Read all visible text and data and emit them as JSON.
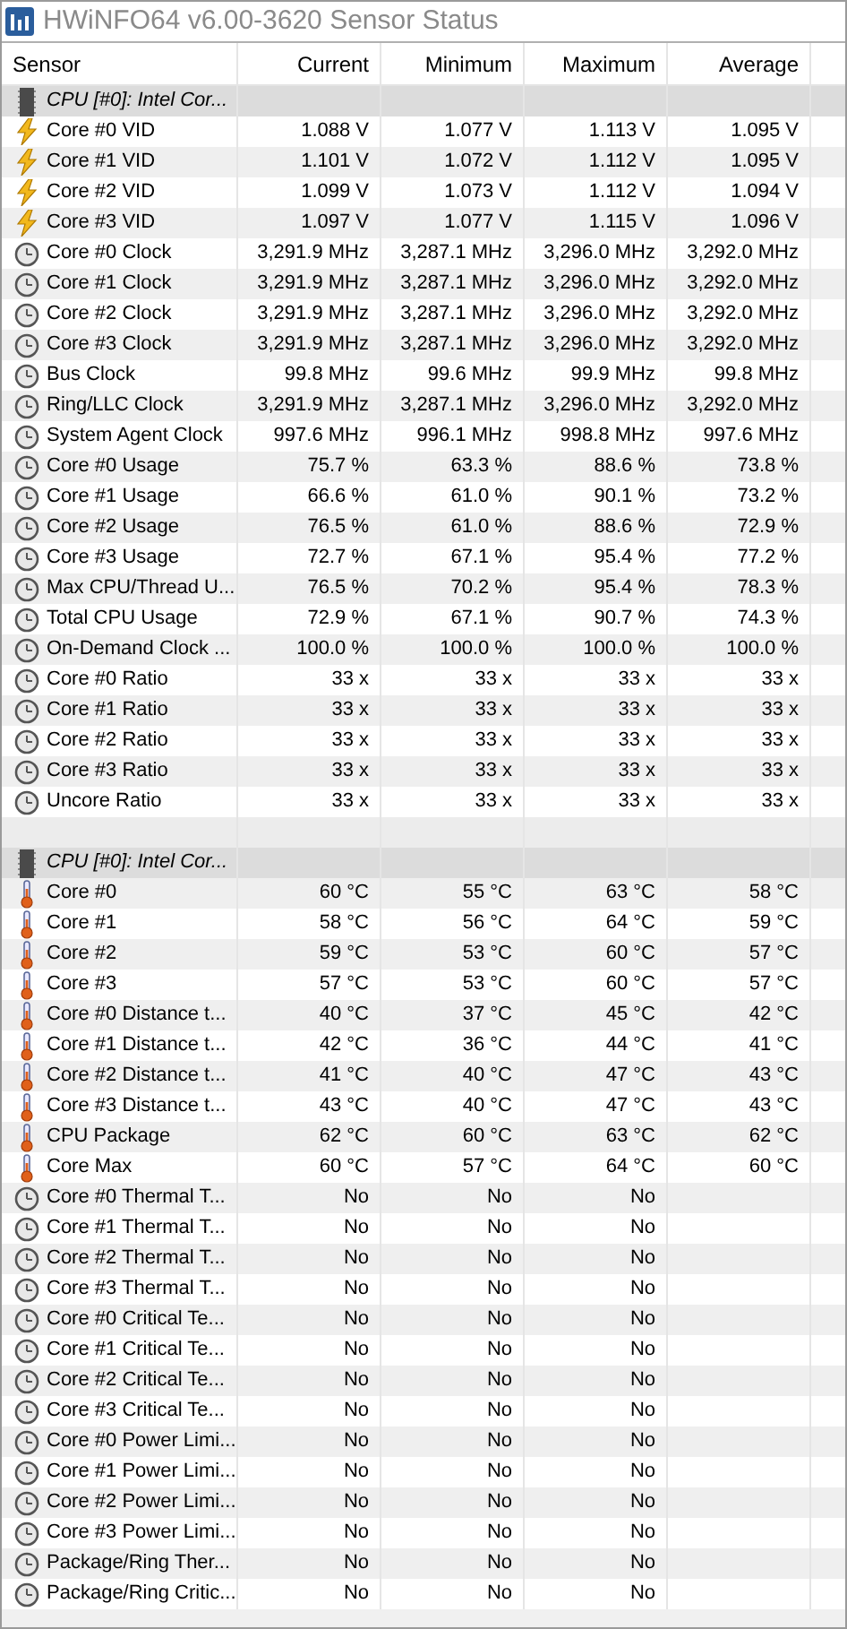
{
  "window": {
    "title": "HWiNFO64 v6.00-3620 Sensor Status"
  },
  "table": {
    "columns": [
      "Sensor",
      "Current",
      "Minimum",
      "Maximum",
      "Average"
    ],
    "rows": [
      {
        "kind": "group",
        "sensor": "CPU [#0]: Intel Cor..."
      },
      {
        "kind": "voltage",
        "sensor": "Core #0 VID",
        "current": "1.088 V",
        "minimum": "1.077 V",
        "maximum": "1.113 V",
        "average": "1.095 V"
      },
      {
        "kind": "voltage",
        "sensor": "Core #1 VID",
        "current": "1.101 V",
        "minimum": "1.072 V",
        "maximum": "1.112 V",
        "average": "1.095 V"
      },
      {
        "kind": "voltage",
        "sensor": "Core #2 VID",
        "current": "1.099 V",
        "minimum": "1.073 V",
        "maximum": "1.112 V",
        "average": "1.094 V"
      },
      {
        "kind": "voltage",
        "sensor": "Core #3 VID",
        "current": "1.097 V",
        "minimum": "1.077 V",
        "maximum": "1.115 V",
        "average": "1.096 V"
      },
      {
        "kind": "clock",
        "sensor": "Core #0 Clock",
        "current": "3,291.9 MHz",
        "minimum": "3,287.1 MHz",
        "maximum": "3,296.0 MHz",
        "average": "3,292.0 MHz"
      },
      {
        "kind": "clock",
        "sensor": "Core #1 Clock",
        "current": "3,291.9 MHz",
        "minimum": "3,287.1 MHz",
        "maximum": "3,296.0 MHz",
        "average": "3,292.0 MHz"
      },
      {
        "kind": "clock",
        "sensor": "Core #2 Clock",
        "current": "3,291.9 MHz",
        "minimum": "3,287.1 MHz",
        "maximum": "3,296.0 MHz",
        "average": "3,292.0 MHz"
      },
      {
        "kind": "clock",
        "sensor": "Core #3 Clock",
        "current": "3,291.9 MHz",
        "minimum": "3,287.1 MHz",
        "maximum": "3,296.0 MHz",
        "average": "3,292.0 MHz"
      },
      {
        "kind": "clock",
        "sensor": "Bus Clock",
        "current": "99.8 MHz",
        "minimum": "99.6 MHz",
        "maximum": "99.9 MHz",
        "average": "99.8 MHz"
      },
      {
        "kind": "clock",
        "sensor": "Ring/LLC Clock",
        "current": "3,291.9 MHz",
        "minimum": "3,287.1 MHz",
        "maximum": "3,296.0 MHz",
        "average": "3,292.0 MHz"
      },
      {
        "kind": "clock",
        "sensor": "System Agent Clock",
        "current": "997.6 MHz",
        "minimum": "996.1 MHz",
        "maximum": "998.8 MHz",
        "average": "997.6 MHz"
      },
      {
        "kind": "clock",
        "sensor": "Core #0 Usage",
        "current": "75.7 %",
        "minimum": "63.3 %",
        "maximum": "88.6 %",
        "average": "73.8 %"
      },
      {
        "kind": "clock",
        "sensor": "Core #1 Usage",
        "current": "66.6 %",
        "minimum": "61.0 %",
        "maximum": "90.1 %",
        "average": "73.2 %"
      },
      {
        "kind": "clock",
        "sensor": "Core #2 Usage",
        "current": "76.5 %",
        "minimum": "61.0 %",
        "maximum": "88.6 %",
        "average": "72.9 %"
      },
      {
        "kind": "clock",
        "sensor": "Core #3 Usage",
        "current": "72.7 %",
        "minimum": "67.1 %",
        "maximum": "95.4 %",
        "average": "77.2 %"
      },
      {
        "kind": "clock",
        "sensor": "Max CPU/Thread U...",
        "current": "76.5 %",
        "minimum": "70.2 %",
        "maximum": "95.4 %",
        "average": "78.3 %"
      },
      {
        "kind": "clock",
        "sensor": "Total CPU Usage",
        "current": "72.9 %",
        "minimum": "67.1 %",
        "maximum": "90.7 %",
        "average": "74.3 %"
      },
      {
        "kind": "clock",
        "sensor": "On-Demand Clock ...",
        "current": "100.0 %",
        "minimum": "100.0 %",
        "maximum": "100.0 %",
        "average": "100.0 %"
      },
      {
        "kind": "clock",
        "sensor": "Core #0 Ratio",
        "current": "33 x",
        "minimum": "33 x",
        "maximum": "33 x",
        "average": "33 x"
      },
      {
        "kind": "clock",
        "sensor": "Core #1 Ratio",
        "current": "33 x",
        "minimum": "33 x",
        "maximum": "33 x",
        "average": "33 x"
      },
      {
        "kind": "clock",
        "sensor": "Core #2 Ratio",
        "current": "33 x",
        "minimum": "33 x",
        "maximum": "33 x",
        "average": "33 x"
      },
      {
        "kind": "clock",
        "sensor": "Core #3 Ratio",
        "current": "33 x",
        "minimum": "33 x",
        "maximum": "33 x",
        "average": "33 x"
      },
      {
        "kind": "clock",
        "sensor": "Uncore Ratio",
        "current": "33 x",
        "minimum": "33 x",
        "maximum": "33 x",
        "average": "33 x"
      },
      {
        "kind": "blank"
      },
      {
        "kind": "group",
        "sensor": "CPU [#0]: Intel Cor..."
      },
      {
        "kind": "temperature",
        "sensor": "Core #0",
        "current": "60 °C",
        "minimum": "55 °C",
        "maximum": "63 °C",
        "average": "58 °C"
      },
      {
        "kind": "temperature",
        "sensor": "Core #1",
        "current": "58 °C",
        "minimum": "56 °C",
        "maximum": "64 °C",
        "average": "59 °C"
      },
      {
        "kind": "temperature",
        "sensor": "Core #2",
        "current": "59 °C",
        "minimum": "53 °C",
        "maximum": "60 °C",
        "average": "57 °C"
      },
      {
        "kind": "temperature",
        "sensor": "Core #3",
        "current": "57 °C",
        "minimum": "53 °C",
        "maximum": "60 °C",
        "average": "57 °C"
      },
      {
        "kind": "temperature",
        "sensor": "Core #0 Distance t...",
        "current": "40 °C",
        "minimum": "37 °C",
        "maximum": "45 °C",
        "average": "42 °C"
      },
      {
        "kind": "temperature",
        "sensor": "Core #1 Distance t...",
        "current": "42 °C",
        "minimum": "36 °C",
        "maximum": "44 °C",
        "average": "41 °C"
      },
      {
        "kind": "temperature",
        "sensor": "Core #2 Distance t...",
        "current": "41 °C",
        "minimum": "40 °C",
        "maximum": "47 °C",
        "average": "43 °C"
      },
      {
        "kind": "temperature",
        "sensor": "Core #3 Distance t...",
        "current": "43 °C",
        "minimum": "40 °C",
        "maximum": "47 °C",
        "average": "43 °C"
      },
      {
        "kind": "temperature",
        "sensor": "CPU Package",
        "current": "62 °C",
        "minimum": "60 °C",
        "maximum": "63 °C",
        "average": "62 °C"
      },
      {
        "kind": "temperature",
        "sensor": "Core Max",
        "current": "60 °C",
        "minimum": "57 °C",
        "maximum": "64 °C",
        "average": "60 °C"
      },
      {
        "kind": "clock",
        "sensor": "Core #0 Thermal T...",
        "current": "No",
        "minimum": "No",
        "maximum": "No"
      },
      {
        "kind": "clock",
        "sensor": "Core #1 Thermal T...",
        "current": "No",
        "minimum": "No",
        "maximum": "No"
      },
      {
        "kind": "clock",
        "sensor": "Core #2 Thermal T...",
        "current": "No",
        "minimum": "No",
        "maximum": "No"
      },
      {
        "kind": "clock",
        "sensor": "Core #3 Thermal T...",
        "current": "No",
        "minimum": "No",
        "maximum": "No"
      },
      {
        "kind": "clock",
        "sensor": "Core #0 Critical Te...",
        "current": "No",
        "minimum": "No",
        "maximum": "No"
      },
      {
        "kind": "clock",
        "sensor": "Core #1 Critical Te...",
        "current": "No",
        "minimum": "No",
        "maximum": "No"
      },
      {
        "kind": "clock",
        "sensor": "Core #2 Critical Te...",
        "current": "No",
        "minimum": "No",
        "maximum": "No"
      },
      {
        "kind": "clock",
        "sensor": "Core #3 Critical Te...",
        "current": "No",
        "minimum": "No",
        "maximum": "No"
      },
      {
        "kind": "clock",
        "sensor": "Core #0 Power Limi...",
        "current": "No",
        "minimum": "No",
        "maximum": "No"
      },
      {
        "kind": "clock",
        "sensor": "Core #1 Power Limi...",
        "current": "No",
        "minimum": "No",
        "maximum": "No"
      },
      {
        "kind": "clock",
        "sensor": "Core #2 Power Limi...",
        "current": "No",
        "minimum": "No",
        "maximum": "No"
      },
      {
        "kind": "clock",
        "sensor": "Core #3 Power Limi...",
        "current": "No",
        "minimum": "No",
        "maximum": "No"
      },
      {
        "kind": "clock",
        "sensor": "Package/Ring Ther...",
        "current": "No",
        "minimum": "No",
        "maximum": "No"
      },
      {
        "kind": "clock",
        "sensor": "Package/Ring Critic...",
        "current": "No",
        "minimum": "No",
        "maximum": "No"
      }
    ]
  }
}
